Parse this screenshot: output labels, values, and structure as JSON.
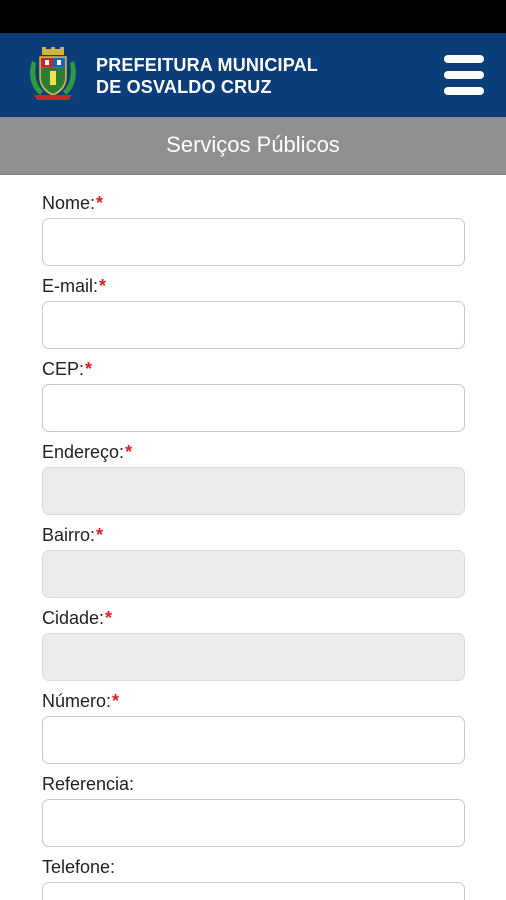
{
  "header": {
    "title_line1": "PREFEITURA MUNICIPAL",
    "title_line2": "DE OSVALDO CRUZ"
  },
  "banner": {
    "title": "Serviços Públicos"
  },
  "form": {
    "required_mark": "*",
    "fields": [
      {
        "label": "Nome:",
        "required": true,
        "value": "",
        "disabled": false
      },
      {
        "label": "E-mail:",
        "required": true,
        "value": "",
        "disabled": false
      },
      {
        "label": "CEP:",
        "required": true,
        "value": "",
        "disabled": false
      },
      {
        "label": "Endereço:",
        "required": true,
        "value": "",
        "disabled": true
      },
      {
        "label": "Bairro:",
        "required": true,
        "value": "",
        "disabled": true
      },
      {
        "label": "Cidade:",
        "required": true,
        "value": "",
        "disabled": true
      },
      {
        "label": "Número:",
        "required": true,
        "value": "",
        "disabled": false
      },
      {
        "label": "Referencia:",
        "required": false,
        "value": "",
        "disabled": false
      },
      {
        "label": "Telefone:",
        "required": false,
        "value": "",
        "disabled": false
      }
    ]
  },
  "colors": {
    "header_bg": "#0a3d7a",
    "banner_bg": "#8f8f8f",
    "required": "#e01b24",
    "disabled_input": "#ececec"
  },
  "icons": {
    "logo": "municipal-coat-of-arms-icon",
    "menu": "hamburger-menu-icon"
  }
}
